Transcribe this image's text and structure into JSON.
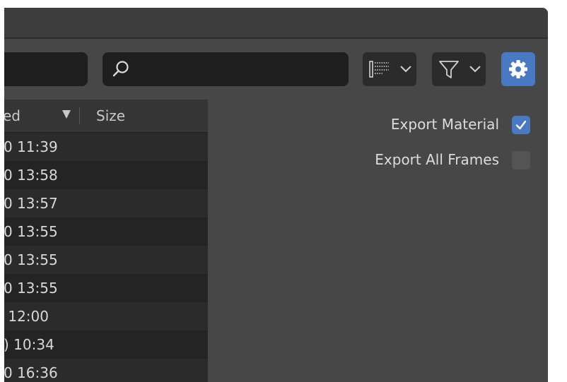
{
  "search": {
    "placeholder": ""
  },
  "toolbar": {
    "display_icon": "display-mode-icon",
    "filter_icon": "filter-icon",
    "settings_icon": "gear-icon",
    "accent_color": "#4a79c3"
  },
  "filelist": {
    "columns": {
      "modified": "ed",
      "size": "Size"
    },
    "rows": [
      "0 11:39",
      "0 13:58",
      "0 13:57",
      "0 13:55",
      "0 13:55",
      "0 13:55",
      " 12:00",
      ") 10:34",
      "0 16:36"
    ]
  },
  "options": {
    "export_material": {
      "label": "Export Material",
      "checked": true
    },
    "export_all_frames": {
      "label": "Export All Frames",
      "checked": false
    }
  }
}
